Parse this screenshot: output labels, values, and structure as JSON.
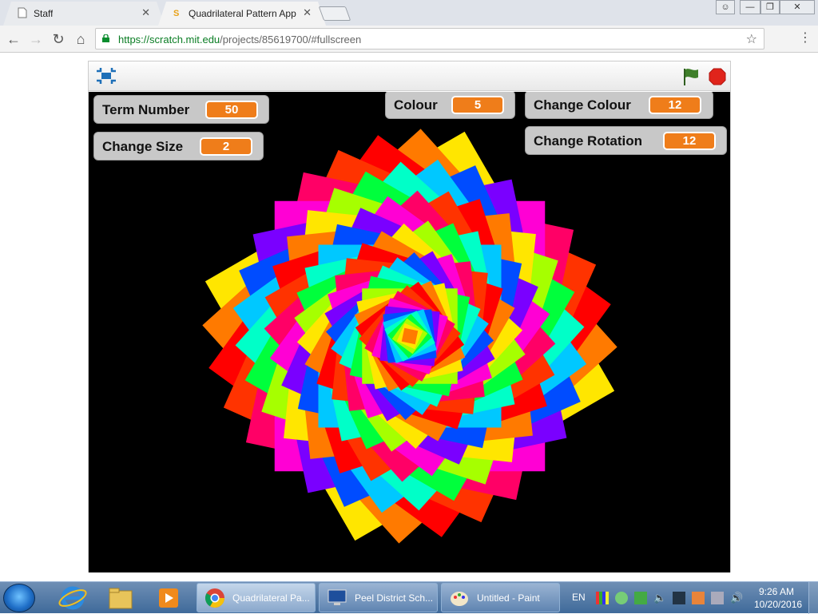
{
  "browser": {
    "tabs": [
      {
        "title": "Staff",
        "active": false
      },
      {
        "title": "Quadrilateral Pattern App",
        "active": true
      }
    ],
    "window_controls": [
      "user-icon",
      "minimize-icon",
      "maximize-icon",
      "close-icon"
    ],
    "url_scheme_host": "https://scratch.mit.edu",
    "url_path": "/projects/85619700/#fullscreen"
  },
  "player": {
    "monitors": [
      {
        "label": "Term Number",
        "value": "50"
      },
      {
        "label": "Change Size",
        "value": "2"
      },
      {
        "label": "Colour",
        "value": "5"
      },
      {
        "label": "Change Colour",
        "value": "12"
      },
      {
        "label": "Change Rotation",
        "value": "12"
      }
    ],
    "buttons": [
      "fullscreen-exit-icon",
      "green-flag-icon",
      "stop-icon"
    ]
  },
  "taskbar": {
    "tasks": [
      {
        "label": "Quadrilateral Pa...",
        "icon": "chrome-icon",
        "active": true
      },
      {
        "label": "Peel District Sch...",
        "icon": "remote-desktop-icon",
        "active": false
      },
      {
        "label": "Untitled - Paint",
        "icon": "paint-icon",
        "active": false
      }
    ],
    "language": "EN",
    "time": "9:26 AM",
    "date": "10/20/2016"
  },
  "colors": {
    "monitor_value": "#ef7d1a",
    "stage_background": "#000000",
    "flag": "#3f7f2a",
    "stop": "#e0241b"
  }
}
